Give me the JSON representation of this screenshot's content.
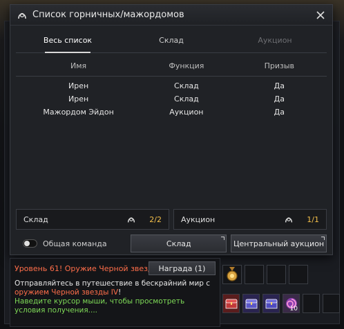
{
  "window": {
    "title": "Список горничных/мажордомов"
  },
  "tabs": [
    {
      "label": "Весь список",
      "active": true
    },
    {
      "label": "Склад",
      "active": false
    },
    {
      "label": "Аукцион",
      "active": false
    }
  ],
  "table": {
    "headers": [
      "Имя",
      "Функция",
      "Призыв"
    ],
    "rows": [
      [
        "Ирен",
        "Склад",
        "Да"
      ],
      [
        "Ирен",
        "Склад",
        "Да"
      ],
      [
        "Мажордом Эйдон",
        "Аукцион",
        "Да"
      ]
    ]
  },
  "stats": {
    "storage": {
      "label": "Склад",
      "value": "2/2"
    },
    "auction": {
      "label": "Аукцион",
      "value": "1/1"
    }
  },
  "bottom": {
    "toggle_label": "Общая команда",
    "storage_button": "Склад",
    "central_auction_button": "Центральный аукцион"
  },
  "quest": {
    "title": "Уровень 61! Оружие Черной звезды ...",
    "reward_button": "Награда (1)",
    "text_part1": "Отправляйтесь в путешествие в бескрайний мир с",
    "text_highlight": "оружием Черной звезды IV",
    "text_part2": "!",
    "hint": "Наведите курсор мыши, чтобы просмотреть условия получения...."
  },
  "reward_slots": {
    "qty_label": "10"
  },
  "colors": {
    "accent_gold": "#f5c04a",
    "quest_red": "#ff6e4a",
    "hint_green": "#7ed957"
  }
}
